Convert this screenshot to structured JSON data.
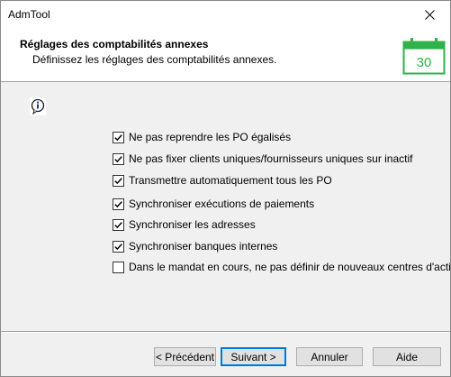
{
  "window": {
    "title": "AdmTool"
  },
  "header": {
    "title": "Réglages des comptabilités annexes",
    "subtitle": "Définissez les réglages des comptabilités annexes.",
    "calendar_day": "30",
    "icon": "calendar-icon",
    "accent_color": "#2fb24a"
  },
  "options": [
    {
      "label": "Ne pas reprendre les PO égalisés",
      "checked": true
    },
    {
      "label": "Ne pas fixer clients uniques/fournisseurs uniques sur inactif",
      "checked": true
    },
    {
      "label": "Transmettre automatiquement tous les PO",
      "checked": true
    },
    {
      "label": "Synchroniser exécutions de paiements",
      "checked": true
    },
    {
      "label": "Synchroniser les adresses",
      "checked": true
    },
    {
      "label": "Synchroniser banques internes",
      "checked": true
    },
    {
      "label": "Dans le mandat en cours, ne pas définir de nouveaux centres d'activité/",
      "checked": false
    }
  ],
  "buttons": {
    "previous": "< Précédent",
    "next": "Suivant >",
    "cancel": "Annuler",
    "help": "Aide"
  }
}
